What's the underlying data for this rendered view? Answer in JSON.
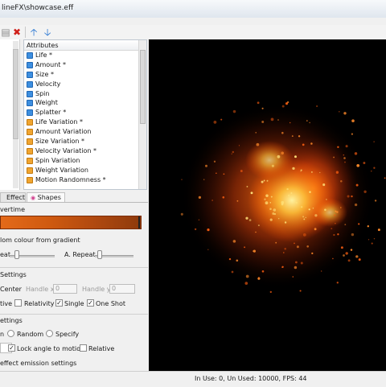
{
  "window": {
    "title": "lineFX\\showcase.eff"
  },
  "toolbar": {
    "icons": [
      "paste-icon",
      "delete-icon",
      "move-up-icon",
      "move-down-icon"
    ]
  },
  "attributes": {
    "header": "Attributes",
    "items": [
      {
        "label": "Life *",
        "icon": "blue"
      },
      {
        "label": "Amount *",
        "icon": "blue"
      },
      {
        "label": "Size *",
        "icon": "blue"
      },
      {
        "label": "Velocity",
        "icon": "blue"
      },
      {
        "label": "Spin",
        "icon": "blue"
      },
      {
        "label": "Weight",
        "icon": "blue"
      },
      {
        "label": "Splatter *",
        "icon": "blue"
      },
      {
        "label": "Life Variation *",
        "icon": "orange"
      },
      {
        "label": "Amount Variation",
        "icon": "orange"
      },
      {
        "label": "Size Variation *",
        "icon": "orange"
      },
      {
        "label": "Velocity Variation *",
        "icon": "orange"
      },
      {
        "label": "Spin Variation",
        "icon": "orange"
      },
      {
        "label": "Weight Variation",
        "icon": "orange"
      },
      {
        "label": "Motion Randomness *",
        "icon": "orange"
      }
    ]
  },
  "tabs": {
    "effect": "Effect",
    "shapes": "Shapes"
  },
  "panel": {
    "overtime_label": "vertime",
    "random_colour_label": "lom colour from gradient",
    "eat_label": "eat",
    "a_repeat_label": "A. Repeat",
    "settings_label": "Settings",
    "center_label": "Center",
    "handle_x_label": "Handle x",
    "handle_x_value": "0",
    "handle_y_label": "Handle y",
    "handle_y_value": "0",
    "tive_label": "tive",
    "relativity_label": "Relativity",
    "single_label": "Single",
    "one_shot_label": "One Shot",
    "ettings_label": "ettings",
    "n_label": "n",
    "random_label": "Random",
    "specify_label": "Specify",
    "lock_angle_label": "Lock angle to motion",
    "relative_label": "Relative",
    "effect_emission_label": "effect emission settings"
  },
  "status": {
    "text": "In Use: 0, Un Used: 10000, FPS: 44"
  },
  "colors": {
    "accent": "#3d8fe0",
    "particle_core": "#ffd23a",
    "particle_outer": "#e04a08"
  }
}
